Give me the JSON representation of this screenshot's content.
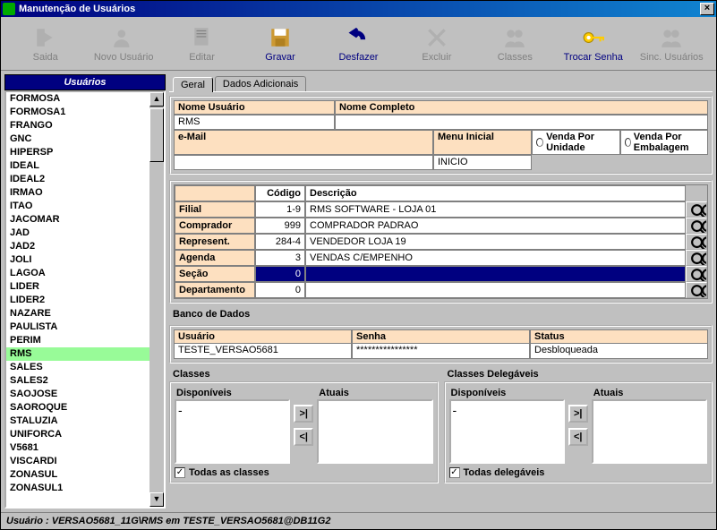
{
  "title": "Manutenção de Usuários",
  "toolbar": {
    "saida": "Saida",
    "novo": "Novo Usuário",
    "editar": "Editar",
    "gravar": "Gravar",
    "desfazer": "Desfazer",
    "excluir": "Excluir",
    "classes": "Classes",
    "trocar": "Trocar Senha",
    "sinc": "Sinc. Usuários"
  },
  "sidebar": {
    "title": "Usuários",
    "items": [
      "FORMOSA",
      "FORMOSA1",
      "FRANGO",
      "GNC",
      "HIPERSP",
      "IDEAL",
      "IDEAL2",
      "IRMAO",
      "ITAO",
      "JACOMAR",
      "JAD",
      "JAD2",
      "JOLI",
      "LAGOA",
      "LIDER",
      "LIDER2",
      "NAZARE",
      "PAULISTA",
      "PERIM",
      "RMS",
      "SALES",
      "SALES2",
      "SAOJOSE",
      "SAOROQUE",
      "STALUZIA",
      "UNIFORCA",
      "V5681",
      "VISCARDI",
      "ZONASUL",
      "ZONASUL1"
    ],
    "selected": "RMS"
  },
  "tabs": {
    "geral": "Geral",
    "dados": "Dados Adicionais"
  },
  "fields": {
    "nomeUsuarioLabel": "Nome Usuário",
    "nomeUsuario": "RMS",
    "nomeCompletoLabel": "Nome Completo",
    "nomeCompleto": "",
    "emailLabel": "e-Mail",
    "email": "",
    "menuInicialLabel": "Menu Inicial",
    "menuInicial": "INICIO",
    "vendaUnidade": "Venda Por Unidade",
    "vendaEmbalagem": "Venda Por Embalagem"
  },
  "grid": {
    "codigoHead": "Código",
    "descricaoHead": "Descrição",
    "rows": [
      {
        "label": "Filial",
        "codigo": "1-9",
        "desc": "RMS SOFTWARE - LOJA 01"
      },
      {
        "label": "Comprador",
        "codigo": "999",
        "desc": "COMPRADOR PADRAO"
      },
      {
        "label": "Represent.",
        "codigo": "284-4",
        "desc": "VENDEDOR LOJA 19"
      },
      {
        "label": "Agenda",
        "codigo": "3",
        "desc": "VENDAS C/EMPENHO"
      },
      {
        "label": "Seção",
        "codigo": "0",
        "desc": "",
        "hl": true
      },
      {
        "label": "Departamento",
        "codigo": "0",
        "desc": ""
      }
    ]
  },
  "db": {
    "title": "Banco de Dados",
    "usuarioLabel": "Usuário",
    "usuario": "TESTE_VERSAO5681",
    "senhaLabel": "Senha",
    "senha": "****************",
    "statusLabel": "Status",
    "status": "Desbloqueada"
  },
  "classes": {
    "title": "Classes",
    "delegTitle": "Classes Delegáveis",
    "disponiveis": "Disponíveis",
    "atuais": "Atuais",
    "todasClasses": "Todas as classes",
    "todasDeleg": "Todas delegáveis",
    "dash": "-"
  },
  "status": "Usuário :  VERSAO5681_11G\\RMS em TESTE_VERSAO5681@DB11G2"
}
